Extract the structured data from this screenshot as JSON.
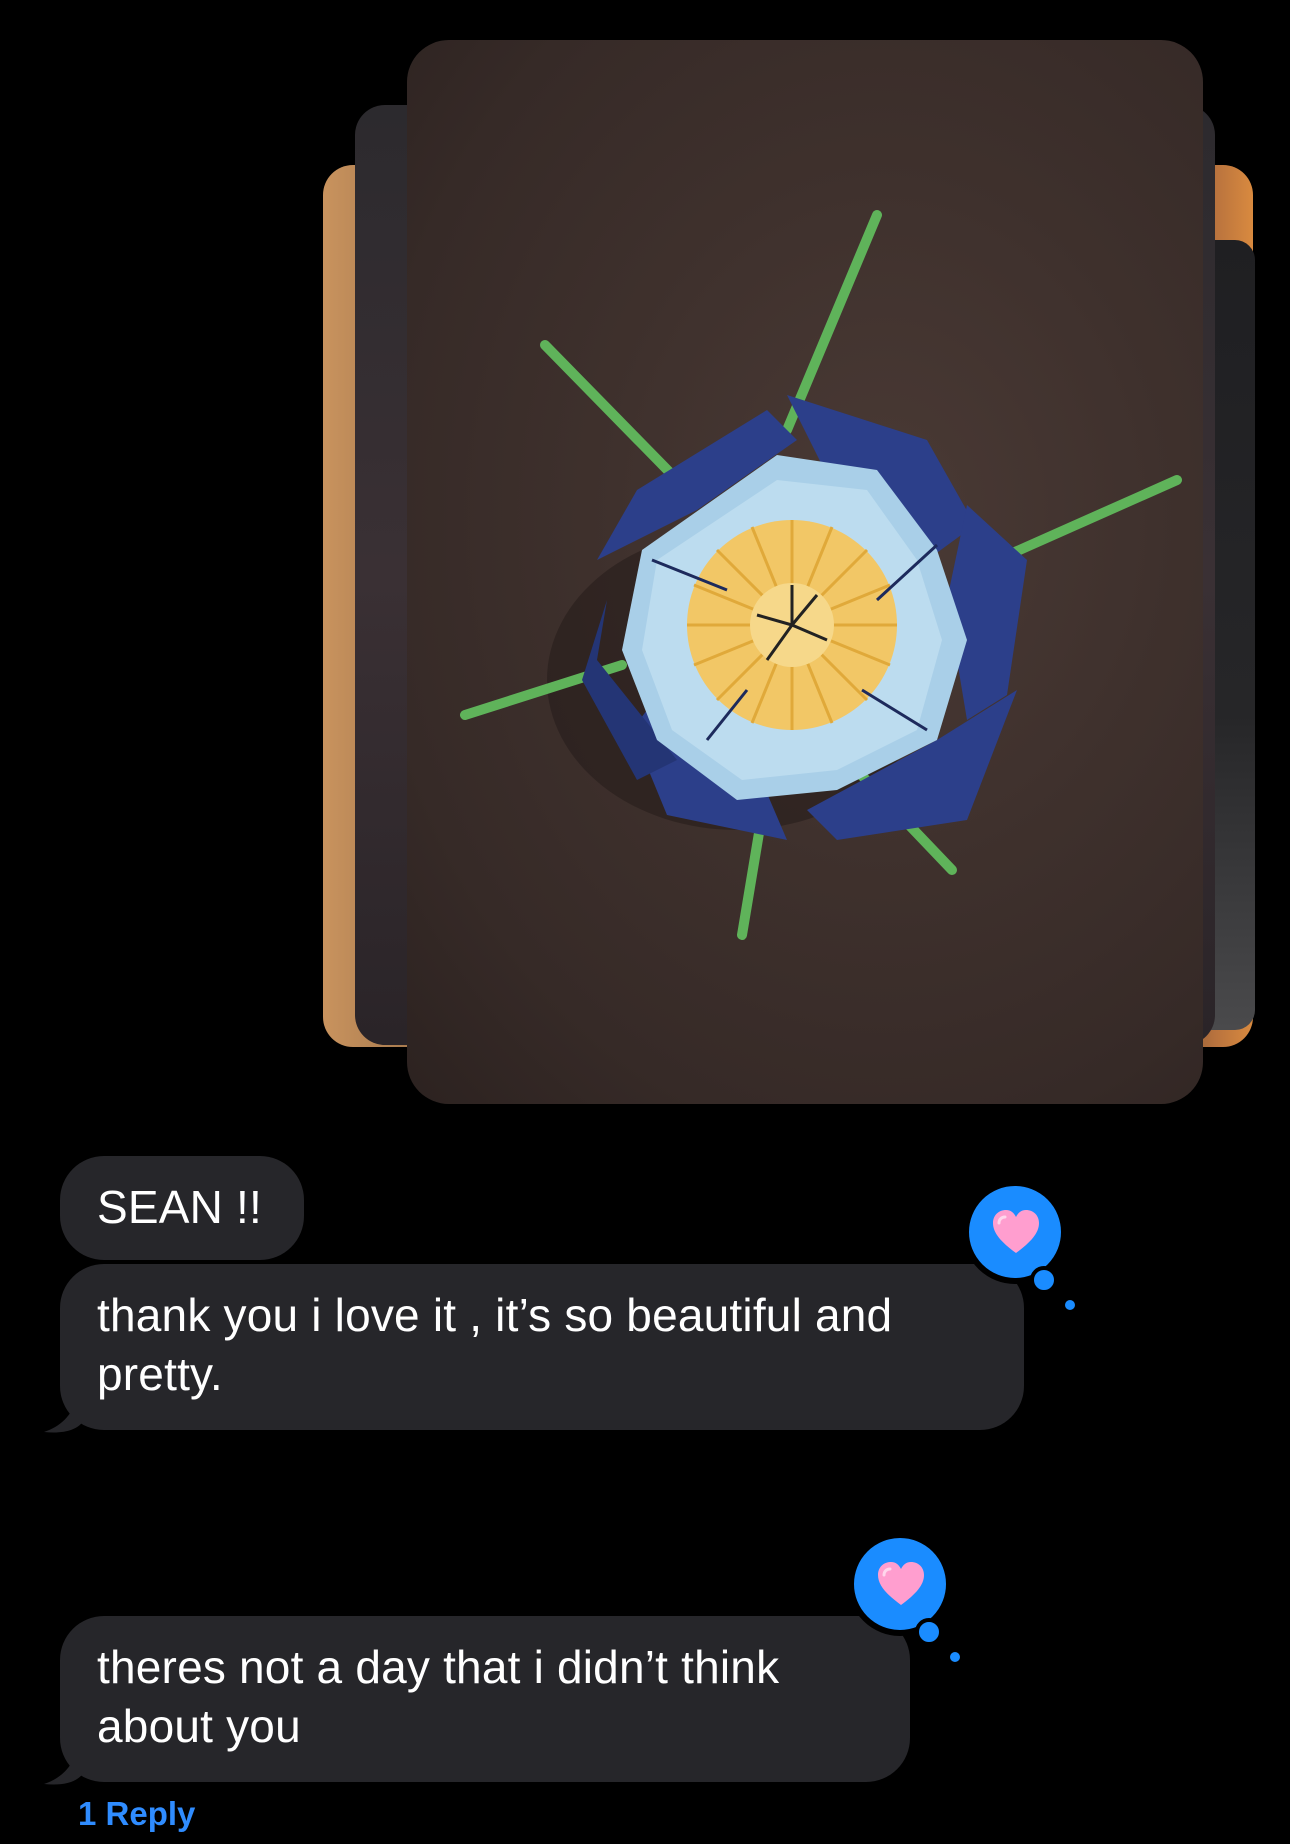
{
  "attachment": {
    "description_icon": "photo-stack-icon"
  },
  "messages": [
    {
      "id": "m1",
      "text": "SEAN !!"
    },
    {
      "id": "m2",
      "text": "thank you i love it , it’s so beautiful and pretty.",
      "reaction": "heart"
    },
    {
      "id": "m3",
      "text": "theres not a day that i didn’t think about you",
      "reaction": "heart"
    }
  ],
  "reply_link": "1 Reply",
  "colors": {
    "background": "#000000",
    "bubble": "#26262a",
    "tapback": "#1a8cff",
    "heart": "#ff9ecf",
    "link": "#2f8cff"
  }
}
